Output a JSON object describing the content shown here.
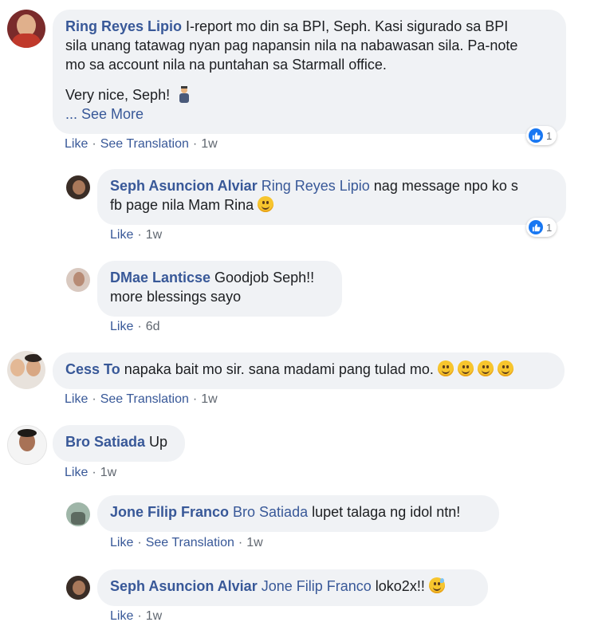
{
  "comments": [
    {
      "author": "Ring Reyes Lipio",
      "text_line1": "I-report mo din sa BPI, Seph. Kasi sigurado sa BPI",
      "text_line2": "sila unang tatawag nyan pag napansin nila na nabawasan sila. Pa-note",
      "text_line3": "mo sa account nila na puntahan sa Starmall office.",
      "text_line4": "Very nice, Seph!",
      "see_more": "... See More",
      "actions": {
        "like": "Like",
        "translate": "See Translation",
        "time": "1w"
      },
      "reaction_count": "1",
      "emoji": "person-emoji"
    },
    {
      "author": "Seph Asuncion Alviar",
      "mention": "Ring Reyes Lipio",
      "text_line1": "nag message npo ko s",
      "text_line2": "fb page nila Mam Rina",
      "actions": {
        "like": "Like",
        "time": "1w"
      },
      "reaction_count": "1"
    },
    {
      "author": "DMae Lanticse",
      "text_line1": "Goodjob Seph!!",
      "text_line2": "more blessings sayo",
      "actions": {
        "like": "Like",
        "time": "6d"
      }
    },
    {
      "author": "Cess To",
      "text": "napaka bait mo sir. sana madami pang tulad mo.",
      "actions": {
        "like": "Like",
        "translate": "See Translation",
        "time": "1w"
      }
    },
    {
      "author": "Bro Satiada",
      "text": "Up",
      "actions": {
        "like": "Like",
        "time": "1w"
      }
    },
    {
      "author": "Jone Filip Franco",
      "mention": "Bro Satiada",
      "text": "lupet talaga ng idol ntn!",
      "actions": {
        "like": "Like",
        "translate": "See Translation",
        "time": "1w"
      }
    },
    {
      "author": "Seph Asuncion Alviar",
      "mention": "Jone Filip Franco",
      "text": "loko2x!!",
      "actions": {
        "like": "Like",
        "time": "1w"
      }
    }
  ],
  "dot": "·",
  "colors": {
    "name": "#385898",
    "bubble": "#f0f2f5",
    "like_blue": "#1877f2"
  }
}
